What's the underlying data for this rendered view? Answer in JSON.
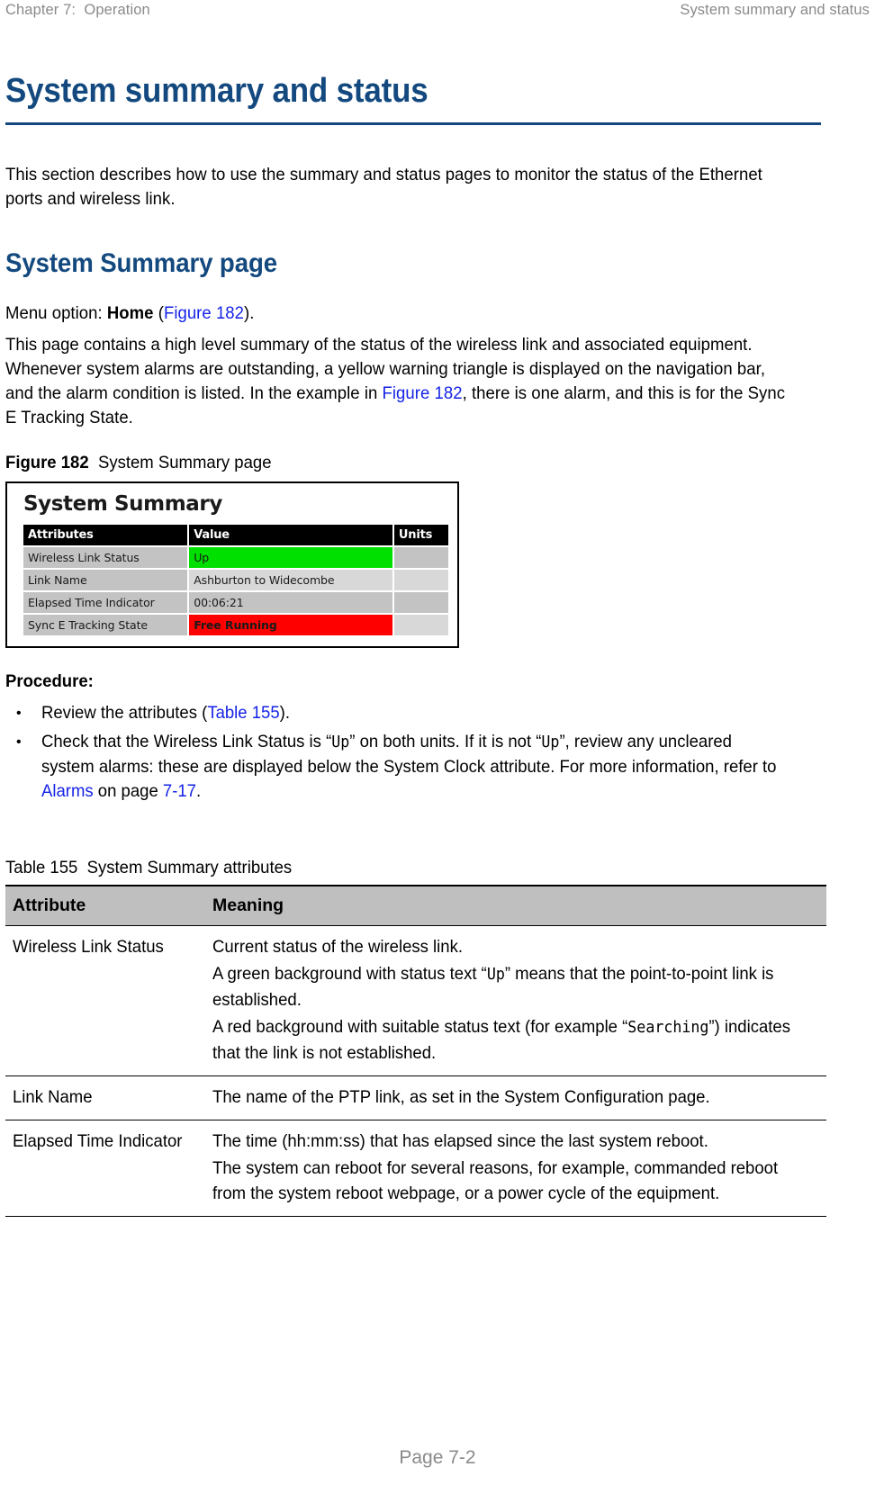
{
  "header": {
    "left": "Chapter 7:  Operation",
    "right": "System summary and status"
  },
  "title": "System summary and status",
  "intro": "This section describes how to use the summary and status pages to monitor the status of the Ethernet ports and wireless link.",
  "section": {
    "heading": "System Summary page",
    "menu_option_prefix": "Menu option: ",
    "menu_option_value": "Home",
    "menu_option_open_paren": " (",
    "menu_option_xref": "Figure 182",
    "menu_option_close": ").",
    "paragraph_part1": "This page contains a high level summary of the status of the wireless link and associated equipment. Whenever system alarms are outstanding, a yellow warning triangle is displayed on the navigation bar, and the alarm condition is listed. In the example in ",
    "paragraph_xref": "Figure 182",
    "paragraph_part2": ", there is one alarm, and this is for the Sync E Tracking State."
  },
  "figure": {
    "caption_label": "Figure 182",
    "caption_text": "System Summary page",
    "app": {
      "title": "System Summary",
      "columns": [
        "Attributes",
        "Value",
        "Units"
      ],
      "rows": [
        {
          "attribute": "Wireless Link Status",
          "value": "Up",
          "units": "",
          "value_style": "green"
        },
        {
          "attribute": "Link Name",
          "value": "Ashburton to Widecombe",
          "units": "",
          "value_style": "light"
        },
        {
          "attribute": "Elapsed Time Indicator",
          "value": "00:06:21",
          "units": "",
          "value_style": "dark"
        },
        {
          "attribute": "Sync E Tracking State",
          "value": "Free Running",
          "units": "",
          "value_style": "red"
        }
      ]
    }
  },
  "procedure": {
    "label": "Procedure:",
    "items": [
      {
        "part1": "Review the attributes (",
        "xref": "Table 155",
        "part2": ")."
      },
      {
        "part1": "Check that the Wireless Link Status is “",
        "mono1": "Up",
        "part2": "” on both units. If it is not “",
        "mono2": "Up",
        "part3": "”, review any uncleared system alarms: these are displayed below the System Clock attribute. For more information, refer to ",
        "xref": "Alarms",
        "part4": " on page ",
        "xref2": "7-17",
        "part5": "."
      }
    ]
  },
  "doc_table": {
    "caption_label": "Table 155",
    "caption_text": "System Summary attributes",
    "columns": [
      "Attribute",
      "Meaning"
    ],
    "rows": [
      {
        "attribute": "Wireless Link Status",
        "meaning": [
          {
            "type": "plain",
            "text": "Current status of the wireless link."
          },
          {
            "type": "mono_mid",
            "before": "A green background with status text “",
            "mono": "Up",
            "after": "” means that the point-to-point link is established."
          },
          {
            "type": "mono_mid",
            "before": "A red background with suitable status text (for example “",
            "mono": "Searching",
            "after": "”) indicates that the link is not established."
          }
        ]
      },
      {
        "attribute": "Link Name",
        "meaning": [
          {
            "type": "plain",
            "text": "The name of the PTP link, as set in the System Configuration page."
          }
        ]
      },
      {
        "attribute": "Elapsed Time Indicator",
        "meaning": [
          {
            "type": "plain",
            "text": "The time (hh:mm:ss) that has elapsed since the last system reboot."
          },
          {
            "type": "plain",
            "text": "The system can reboot for several reasons, for example, commanded reboot from the system reboot webpage, or a power cycle of the equipment."
          }
        ]
      }
    ]
  },
  "footer": {
    "page_number": "Page 7-2"
  },
  "colors": {
    "brand_blue": "#13497E",
    "xref_blue": "#1423E6",
    "status_green": "#00e000",
    "status_red": "#ff0000",
    "table_header_gray": "#bfbfbf",
    "header_text_gray": "#8a8a8a"
  }
}
